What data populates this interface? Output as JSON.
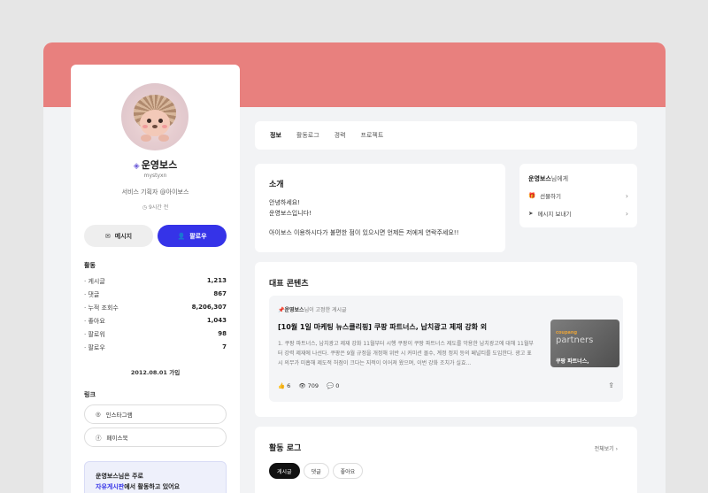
{
  "profile": {
    "nickname": "운영보스",
    "user_id": "mystyxn",
    "role": "서비스 기획자 @아이보스",
    "last_active": "9시간 전",
    "message_label": "메시지",
    "follow_label": "팔로우",
    "activity_title": "활동",
    "stats": [
      {
        "label": "· 게시글",
        "value": "1,213"
      },
      {
        "label": "· 댓글",
        "value": "867"
      },
      {
        "label": "· 누적 조회수",
        "value": "8,206,307"
      },
      {
        "label": "· 좋아요",
        "value": "1,043"
      },
      {
        "label": "· 팔로워",
        "value": "98"
      },
      {
        "label": "· 팔로우",
        "value": "7"
      }
    ],
    "joined": "2012.08.01 가입",
    "links_title": "링크",
    "links": [
      {
        "label": "인스타그램",
        "icon": "instagram-icon"
      },
      {
        "label": "페이스북",
        "icon": "facebook-icon"
      }
    ],
    "note_line1": "운영보스님은 주로",
    "note_highlight": "자유게시판",
    "note_line2_rest": "에서 활동하고 있어요"
  },
  "tabs": [
    "정보",
    "활동로그",
    "경력",
    "프로젝트"
  ],
  "intro": {
    "title": "소개",
    "line1": "안녕하세요!",
    "line2": "운영보스입니다!",
    "line3": "아이보스 이용하시다가 불편한 점이 있으시면 언제든 저에게 연락주세요!!"
  },
  "gift_box": {
    "name": "운영보스",
    "suffix": "님에게",
    "gift_label": "선물하기",
    "send_label": "메시지 보내기"
  },
  "featured": {
    "title": "대표 콘텐츠",
    "pin_name": "운영보스",
    "pin_suffix": "님이 고정한 게시글",
    "post_title": "[10월 1일 마케팅 뉴스클리핑] 쿠팡 파트너스, 납치광고 제재 강화 외",
    "post_excerpt": "1. 쿠팡 파트너스, 납치광고 제재 강화 11월부터 시행 쿠팡이 쿠팡 파트너스 제도를 악용한 납치광고에 대해 11월부터 강력 제재에 나선다. 쿠팡은 9월 규정을 개정해 위반 시 커미션 몰수, 계정 정지 등의 페널티를 도입한다. 광고 표시 의무가 미흡해 제도적 허점이 크다는 지적이 이어져 왔으며, 이번 강화 조치가 실효...",
    "thumb_brand": "coupang",
    "thumb_word": "partners",
    "thumb_caption": "쿠팡 파트너스,",
    "likes": "6",
    "views": "709",
    "comments": "0"
  },
  "activity_log": {
    "title": "활동 로그",
    "view_all": "전체보기 ›",
    "chips": [
      "게시글",
      "댓글",
      "좋아요"
    ]
  }
}
